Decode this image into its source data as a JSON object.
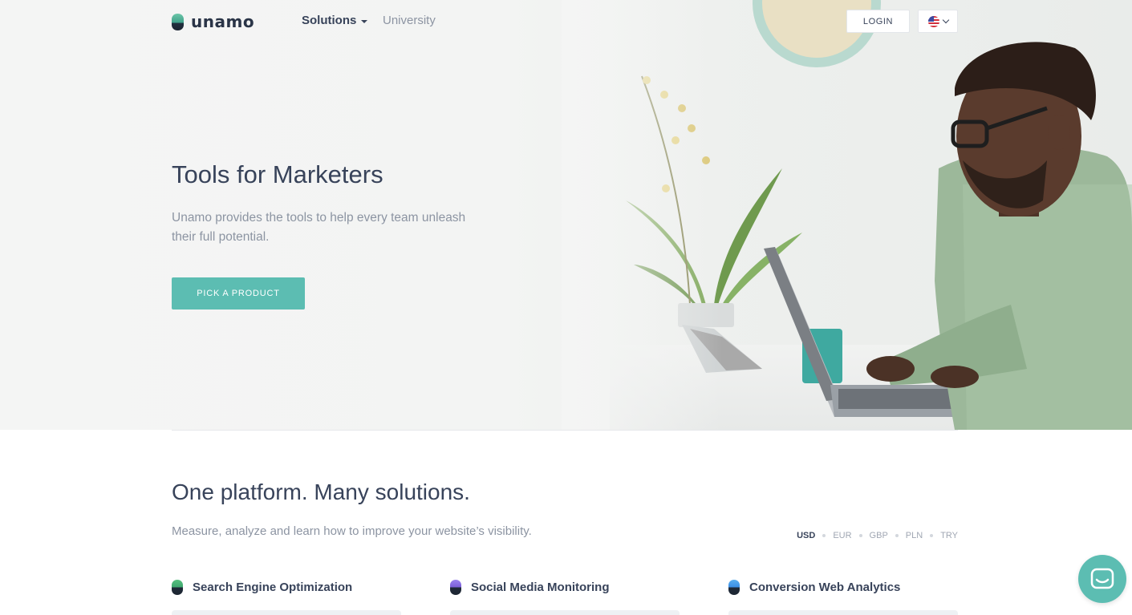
{
  "brand": {
    "name": "unamo"
  },
  "nav": {
    "solutions_label": "Solutions",
    "university_label": "University",
    "login_label": "LOGIN",
    "language_flag": "us-flag-icon"
  },
  "hero": {
    "title": "Tools for Marketers",
    "subtitle": "Unamo provides the tools to help every team unleash their full potential.",
    "cta_label": "PICK A PRODUCT"
  },
  "section": {
    "title": "One platform. Many solutions.",
    "subtitle": "Measure, analyze and learn how to improve your website’s visibility.",
    "currencies": [
      "USD",
      "EUR",
      "GBP",
      "PLN",
      "TRY"
    ],
    "active_currency": "USD"
  },
  "products": [
    {
      "name": "Search Engine Optimization",
      "icon_color": "#3fa66f"
    },
    {
      "name": "Social Media Monitoring",
      "icon_color": "#7a5ed8"
    },
    {
      "name": "Conversion Web Analytics",
      "icon_color": "#3a8ee6"
    }
  ],
  "colors": {
    "accent": "#5cbdb2",
    "text": "#38435a",
    "muted": "#8c94a2"
  }
}
